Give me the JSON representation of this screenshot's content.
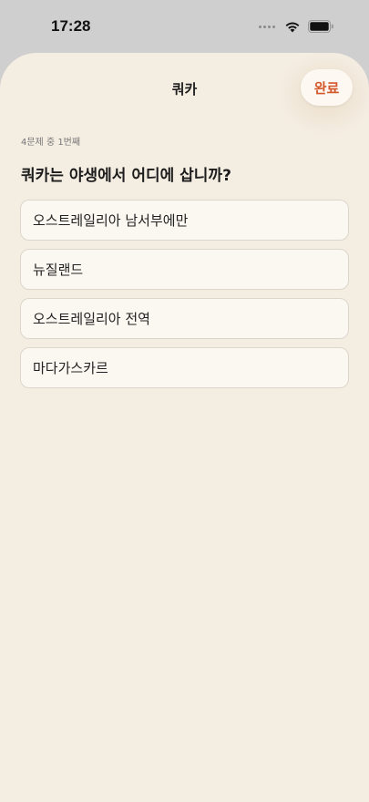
{
  "status_bar": {
    "time": "17:28",
    "icons": [
      "cellular-signal-icon",
      "wifi-icon",
      "battery-icon"
    ]
  },
  "sheet": {
    "title": "쿼카",
    "done_label": "완료"
  },
  "quiz": {
    "progress": "4문제 중 1번째",
    "question": "쿼카는 야생에서 어디에 삽니까?",
    "options": [
      "오스트레일리아 남서부에만",
      "뉴질랜드",
      "오스트레일리아 전역",
      "마다가스카르"
    ]
  },
  "colors": {
    "sheet_background": "#f4ede2",
    "accent": "#d4572a",
    "option_border": "#dcd6cc",
    "option_background": "#fbf8f2"
  }
}
